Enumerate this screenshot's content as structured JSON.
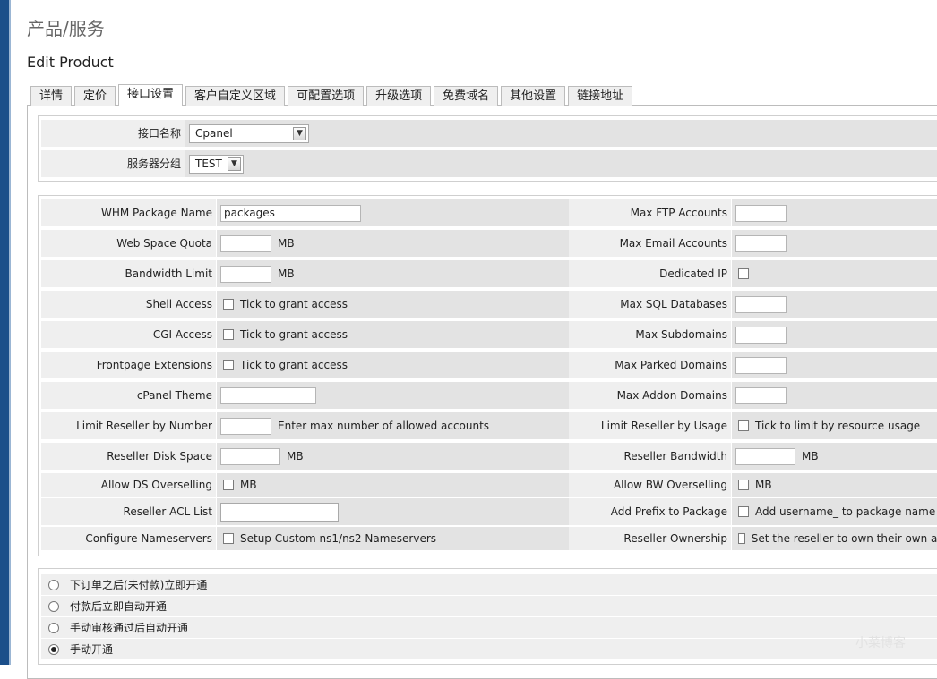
{
  "header": {
    "page_title": "产品/服务",
    "subtitle": "Edit Product"
  },
  "tabs": [
    {
      "label": "详情",
      "active": false
    },
    {
      "label": "定价",
      "active": false
    },
    {
      "label": "接口设置",
      "active": true
    },
    {
      "label": "客户自定义区域",
      "active": false
    },
    {
      "label": "可配置选项",
      "active": false
    },
    {
      "label": "升级选项",
      "active": false
    },
    {
      "label": "免费域名",
      "active": false
    },
    {
      "label": "其他设置",
      "active": false
    },
    {
      "label": "链接地址",
      "active": false
    }
  ],
  "module": {
    "name_label": "接口名称",
    "name_value": "Cpanel",
    "group_label": "服务器分组",
    "group_value": "TEST"
  },
  "left": {
    "whm_package_label": "WHM Package Name",
    "whm_package_value": "packages",
    "web_space_label": "Web Space Quota",
    "web_space_unit": "MB",
    "bandwidth_label": "Bandwidth Limit",
    "bandwidth_unit": "MB",
    "shell_label": "Shell Access",
    "shell_text": "Tick to grant access",
    "cgi_label": "CGI Access",
    "cgi_text": "Tick to grant access",
    "frontpage_label": "Frontpage Extensions",
    "frontpage_text": "Tick to grant access",
    "theme_label": "cPanel Theme",
    "limit_number_label": "Limit Reseller by Number",
    "limit_number_text": "Enter max number of allowed accounts",
    "disk_label": "Reseller Disk Space",
    "disk_unit": "MB",
    "ds_over_label": "Allow DS Overselling",
    "ds_over_text": "MB",
    "acl_label": "Reseller ACL List",
    "ns_label": "Configure Nameservers",
    "ns_text": "Setup Custom ns1/ns2 Nameservers"
  },
  "right": {
    "ftp_label": "Max FTP Accounts",
    "email_label": "Max Email Accounts",
    "dedicated_label": "Dedicated IP",
    "sql_label": "Max SQL Databases",
    "sub_label": "Max Subdomains",
    "parked_label": "Max Parked Domains",
    "addon_label": "Max Addon Domains",
    "limit_usage_label": "Limit Reseller by Usage",
    "limit_usage_text": "Tick to limit by resource usage",
    "reseller_bw_label": "Reseller Bandwidth",
    "reseller_bw_unit": "MB",
    "bw_over_label": "Allow BW Overselling",
    "bw_over_text": "MB",
    "prefix_label": "Add Prefix to Package",
    "prefix_text": "Add username_ to package name",
    "ownership_label": "Reseller Ownership",
    "ownership_text": "Set the reseller to own their own ac"
  },
  "provisioning": [
    {
      "label": "下订单之后(未付款)立即开通",
      "checked": false
    },
    {
      "label": "付款后立即自动开通",
      "checked": false
    },
    {
      "label": "手动审核通过后自动开通",
      "checked": false
    },
    {
      "label": "手动开通",
      "checked": true
    }
  ],
  "watermark": "小菜博客"
}
